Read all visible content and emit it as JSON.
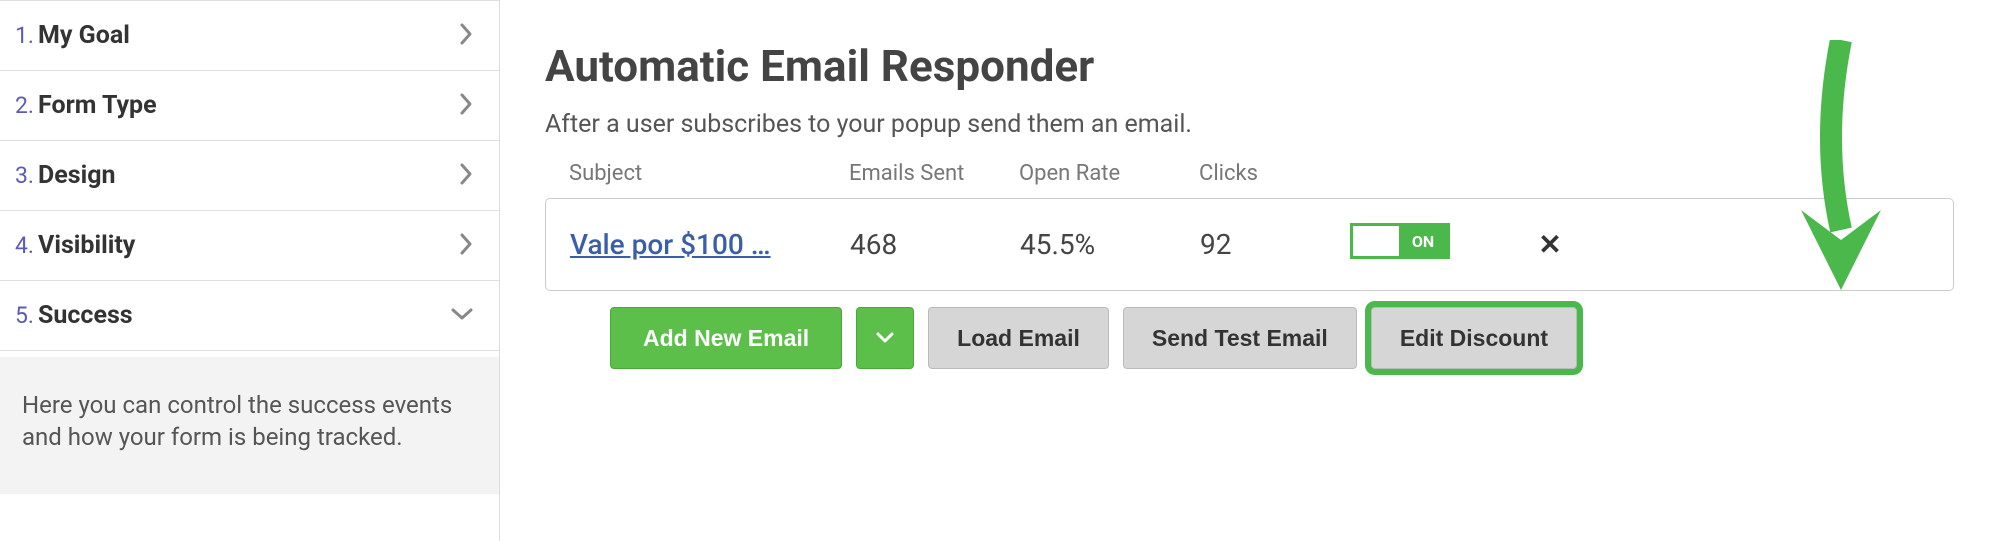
{
  "sidebar": {
    "steps": [
      {
        "num": "1.",
        "label": "My Goal",
        "expanded": false
      },
      {
        "num": "2.",
        "label": "Form Type",
        "expanded": false
      },
      {
        "num": "3.",
        "label": "Design",
        "expanded": false
      },
      {
        "num": "4.",
        "label": "Visibility",
        "expanded": false
      },
      {
        "num": "5.",
        "label": "Success",
        "expanded": true
      }
    ],
    "note": "Here you can control the success events and how your form is being tracked."
  },
  "main": {
    "title": "Automatic Email Responder",
    "subtitle": "After a user subscribes to your popup send them an email.",
    "columns": {
      "subject": "Subject",
      "sent": "Emails Sent",
      "open": "Open Rate",
      "clicks": "Clicks"
    },
    "row": {
      "subject": "Vale por $100 …",
      "sent": "468",
      "open": "45.5%",
      "clicks": "92",
      "toggle": "ON"
    },
    "buttons": {
      "add": "Add New Email",
      "load": "Load Email",
      "test": "Send Test Email",
      "edit": "Edit Discount"
    }
  }
}
